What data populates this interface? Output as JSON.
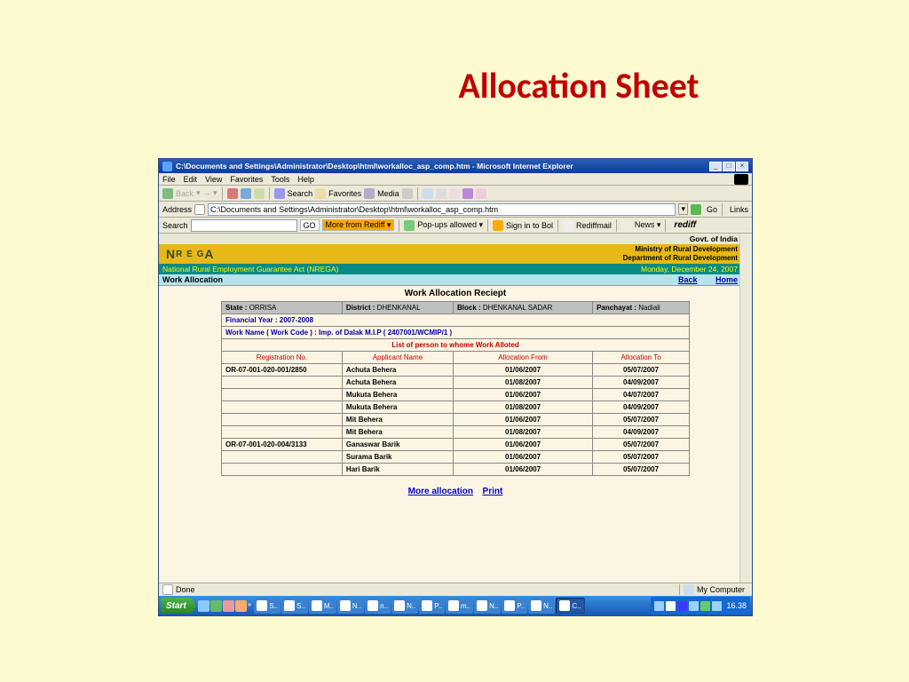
{
  "slide": {
    "title": "Allocation Sheet"
  },
  "window": {
    "title": "C:\\Documents and Settings\\Administrator\\Desktop\\html\\workalloc_asp_comp.htm - Microsoft Internet Explorer",
    "menus": [
      "File",
      "Edit",
      "View",
      "Favorites",
      "Tools",
      "Help"
    ],
    "toolbar": {
      "back": "Back",
      "search": "Search",
      "favorites": "Favorites",
      "media": "Media"
    },
    "address": {
      "label": "Address",
      "value": "C:\\Documents and Settings\\Administrator\\Desktop\\html\\workalloc_asp_comp.htm",
      "go": "Go",
      "links": "Links"
    },
    "searchbar": {
      "label": "Search",
      "go": "GO",
      "more": "More from Rediff ▾",
      "popups": "Pop-ups allowed ▾",
      "signin": "Sign in to Bol",
      "rmail": "Rediffmail",
      "news": "News ▾",
      "brand": "rediff"
    },
    "status": {
      "left": "Done",
      "zone": "My Computer"
    }
  },
  "page": {
    "govt": "Govt. of India",
    "ministry1": "Ministry of Rural Development",
    "ministry2": "Department of Rural Development",
    "act": "National Rural Employment Guarantee Act (NREGA)",
    "date": "Monday, December 24, 2007",
    "wa_title": "Work Allocation",
    "back": "Back",
    "home": "Home",
    "receipt_title": "Work Allocation Reciept",
    "info": {
      "state_label": "State :",
      "state": "ORRISA",
      "district_label": "District :",
      "district": "DHENKANAL",
      "block_label": "Block :",
      "block": "DHENKANAL SADAR",
      "panchayat_label": "Panchayat :",
      "panchayat": "Nadiali"
    },
    "fy": "Financial Year :  2007-2008",
    "work_name": "Work Name  ( Work Code ) :   Imp. of Dalak M.I.P ( 2407001/WCMIP/1 )",
    "list_title": "List of person to whome Work Alloted",
    "cols": {
      "reg": "Registration No.",
      "name": "Applicant Name",
      "from": "Allocation From",
      "to": "Allocation To"
    },
    "rows": [
      {
        "reg": "OR-07-001-020-001/2850",
        "name": "Achuta Behera",
        "from": "01/06/2007",
        "to": "05/07/2007"
      },
      {
        "reg": "",
        "name": "Achuta Behera",
        "from": "01/08/2007",
        "to": "04/09/2007"
      },
      {
        "reg": "",
        "name": "Mukuta Behera",
        "from": "01/06/2007",
        "to": "04/07/2007"
      },
      {
        "reg": "",
        "name": "Mukuta Behera",
        "from": "01/08/2007",
        "to": "04/09/2007"
      },
      {
        "reg": "",
        "name": "Mit Behera",
        "from": "01/06/2007",
        "to": "05/07/2007"
      },
      {
        "reg": "",
        "name": "Mit Behera",
        "from": "01/08/2007",
        "to": "04/09/2007"
      },
      {
        "reg": "OR-07-001-020-004/3133",
        "name": "Ganaswar Barik",
        "from": "01/06/2007",
        "to": "05/07/2007"
      },
      {
        "reg": "",
        "name": "Surama Barik",
        "from": "01/06/2007",
        "to": "05/07/2007"
      },
      {
        "reg": "",
        "name": "Hari Barik",
        "from": "01/06/2007",
        "to": "05/07/2007"
      }
    ],
    "links": {
      "more": "More allocation",
      "print": "Print"
    }
  },
  "taskbar": {
    "start": "Start",
    "tasks": [
      "S..",
      "S..",
      "M..",
      "N..",
      "n..",
      "N..",
      "P..",
      "m..",
      "N..",
      "P..",
      "N..",
      "C.."
    ],
    "time": "16.38"
  }
}
